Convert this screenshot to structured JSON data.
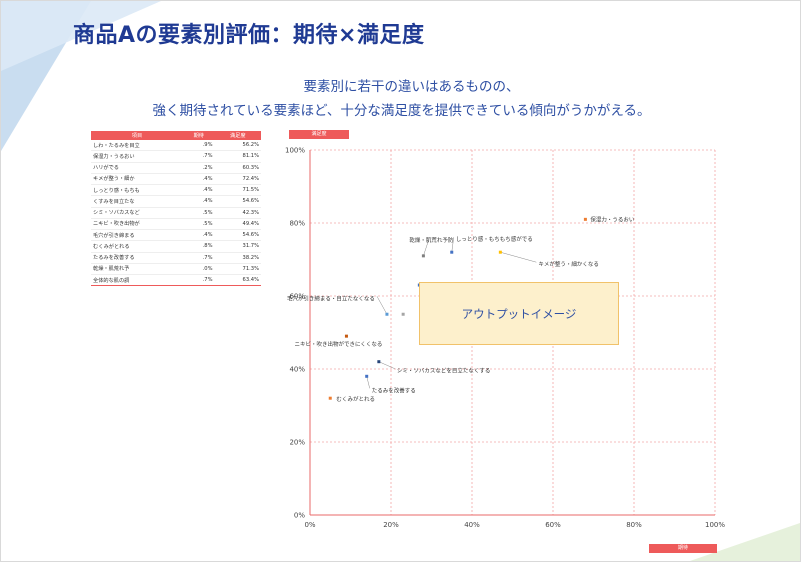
{
  "title": "商品Aの要素別評価：期待×満足度",
  "subtitle_line1": "要素別に若干の違いはあるものの、",
  "subtitle_line2": "強く期待されている要素ほど、十分な満足度を提供できている傾向がうかがえる。",
  "table": {
    "headers": [
      "項目",
      "期待",
      "満足度"
    ],
    "rows": [
      [
        "しわ・たるみを目立",
        ".9%",
        "56.2%"
      ],
      [
        "保湿力・うるおい",
        ".7%",
        "81.1%"
      ],
      [
        "ハリがでる",
        ".2%",
        "60.3%"
      ],
      [
        "キメが整う・細か",
        ".4%",
        "72.4%"
      ],
      [
        "しっとり感・もちも",
        ".4%",
        "71.5%"
      ],
      [
        "くすみを目立たな",
        ".4%",
        "54.6%"
      ],
      [
        "シミ・ソバカスなど",
        ".5%",
        "42.3%"
      ],
      [
        "ニキビ・吹き出物が",
        ".5%",
        "49.4%"
      ],
      [
        "毛穴が引き締まる",
        ".4%",
        "54.6%"
      ],
      [
        "むくみがとれる",
        ".8%",
        "31.7%"
      ],
      [
        "たるみを改善する",
        ".7%",
        "38.2%"
      ],
      [
        "乾燥・肌荒れ予",
        ".0%",
        "71.3%"
      ],
      [
        "全体的な肌の調",
        ".7%",
        "63.4%"
      ]
    ]
  },
  "y_axis_label": "満足度",
  "x_axis_label": "期待",
  "output_label": "アウトプットイメージ",
  "chart_data": {
    "type": "scatter",
    "xlabel": "期待",
    "ylabel": "満足度",
    "xlim": [
      0,
      100
    ],
    "ylim": [
      0,
      100
    ],
    "x_ticks": [
      "0%",
      "20%",
      "40%",
      "60%",
      "80%",
      "100%"
    ],
    "y_ticks": [
      "0%",
      "20%",
      "40%",
      "60%",
      "80%",
      "100%"
    ],
    "grid": true,
    "points": [
      {
        "label": "保湿力・うるおい",
        "x": 68,
        "y": 81,
        "color": "#ed7d31"
      },
      {
        "label": "乾燥・肌荒れ予防",
        "x": 28,
        "y": 71,
        "color": "#7f7f7f"
      },
      {
        "label": "しっとり感・もちもち感がでる",
        "x": 35,
        "y": 72,
        "color": "#4472c4"
      },
      {
        "label": "キメが整う・細かくなる",
        "x": 47,
        "y": 72,
        "color": "#ffc000"
      },
      {
        "label": "毛穴が引き締まる・目立たなくなる",
        "x": 19,
        "y": 55,
        "color": "#5b9bd5"
      },
      {
        "label": "ニキビ・吹き出物ができにくくなる",
        "x": 9,
        "y": 49,
        "color": "#c55a11"
      },
      {
        "label": "シミ・ソバカスなどを目立たなくする",
        "x": 17,
        "y": 42,
        "color": "#264478"
      },
      {
        "label": "たるみを改善する",
        "x": 14,
        "y": 38,
        "color": "#4472c4"
      },
      {
        "label": "むくみがとれる",
        "x": 5,
        "y": 32,
        "color": "#ed7d31"
      },
      {
        "label": "",
        "x": 27,
        "y": 63,
        "color": "#4472c4"
      },
      {
        "label": "",
        "x": 23,
        "y": 55,
        "color": "#a5a5a5"
      },
      {
        "label": "",
        "x": 28,
        "y": 57,
        "color": "#4472c4"
      }
    ]
  }
}
